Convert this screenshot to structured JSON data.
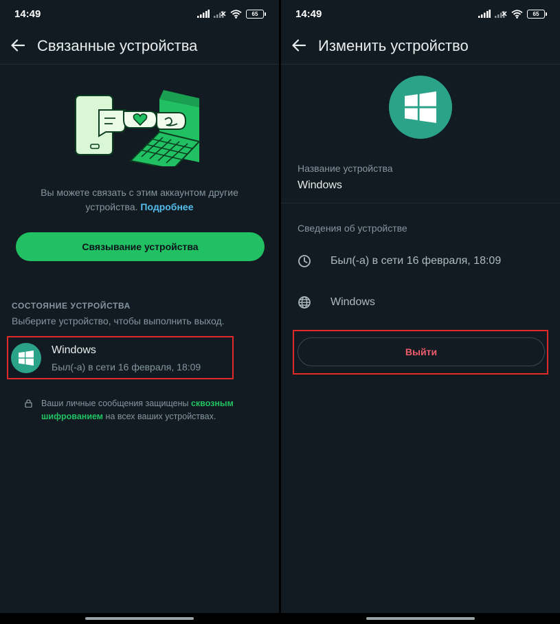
{
  "status_bar": {
    "time": "14:49",
    "battery": "65"
  },
  "linked_devices": {
    "title": "Связанные устройства",
    "intro_text": "Вы можете связать с этим аккаунтом другие устройства.",
    "intro_link": "Подробнее",
    "link_button": "Связывание устройства",
    "section_header": "СОСТОЯНИЕ УСТРОЙСТВА",
    "section_subtitle": "Выберите устройство, чтобы выполнить выход.",
    "device": {
      "name": "Windows",
      "status": "Был(-а) в сети 16 февраля, 18:09"
    },
    "encryption": {
      "prefix": "Ваши личные сообщения защищены",
      "link": "сквозным шифрованием",
      "suffix": "на всех ваших устройствах."
    }
  },
  "edit_device": {
    "title": "Изменить устройство",
    "name_label": "Название устройства",
    "name_value": "Windows",
    "details_label": "Сведения об устройстве",
    "last_seen": "Был(-а) в сети 16 февраля, 18:09",
    "platform": "Windows",
    "logout_button": "Выйти"
  },
  "colors": {
    "background": "#111b21",
    "accent_green": "#21c063",
    "link_blue": "#53bdeb",
    "danger_red": "#f15c6d",
    "highlight_border": "#e32a2a",
    "avatar_teal": "#2aa389"
  },
  "icons": [
    "back-arrow-icon",
    "windows-logo-icon",
    "clock-icon",
    "globe-icon",
    "lock-icon",
    "signal-icon",
    "wifi-icon",
    "battery-icon"
  ]
}
